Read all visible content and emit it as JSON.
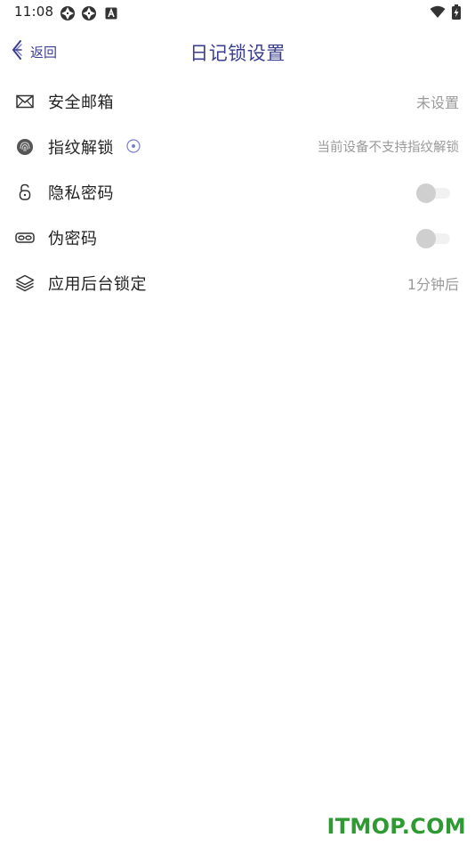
{
  "status_bar": {
    "time": "11:08",
    "icons": [
      "app-notification-icon",
      "app-notification-icon",
      "keyboard-a-icon",
      "wifi-icon",
      "battery-charging-icon"
    ]
  },
  "nav": {
    "back_label": "返回",
    "title": "日记锁设置"
  },
  "settings": {
    "items": [
      {
        "icon": "mail-icon",
        "label": "安全邮箱",
        "value": "未设置"
      },
      {
        "icon": "fingerprint-icon",
        "label": "指纹解锁",
        "value": "当前设备不支持指纹解锁",
        "info_icon": "info-circle-icon"
      },
      {
        "icon": "lock-open-icon",
        "label": "隐私密码",
        "toggle": false
      },
      {
        "icon": "mask-icon",
        "label": "伪密码",
        "toggle": false
      },
      {
        "icon": "layers-icon",
        "label": "应用后台锁定",
        "value": "1分钟后"
      }
    ]
  },
  "watermark": "ITMOP.COM",
  "colors": {
    "accent": "#3b3f8f",
    "secondary_text": "#9a9a9a",
    "toggle_knob_off": "#cfcfcf",
    "watermark": "#2f9a33"
  }
}
